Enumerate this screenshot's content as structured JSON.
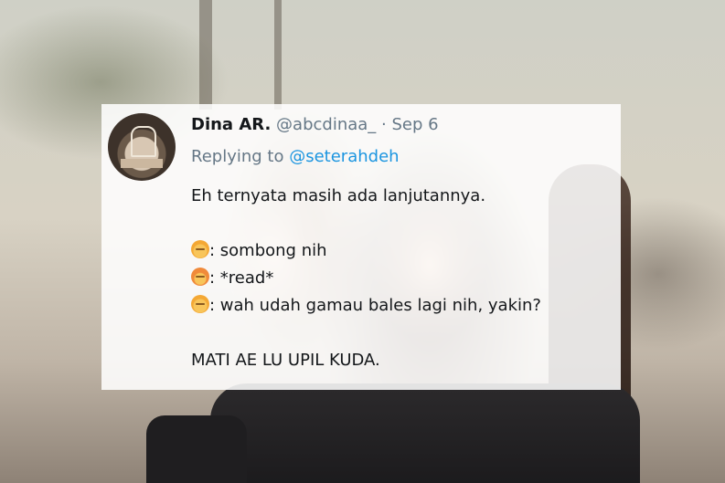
{
  "tweet": {
    "display_name": "Dina AR.",
    "handle": "@abcdinaa_",
    "separator": "·",
    "date": "Sep 6",
    "replying_prefix": "Replying to",
    "replying_to": "@seterahdeh",
    "lines": [
      "Eh ternyata masih ada lanjutannya.",
      "",
      ": sombong nih",
      ": *read*",
      ": wah udah gamau bales lagi nih, yakin?",
      "",
      "MATI AE LU UPIL KUDA."
    ],
    "line_icons": [
      "",
      "",
      "boy-emoji-icon",
      "girl-emoji-icon",
      "boy-emoji-icon",
      "",
      ""
    ]
  },
  "colors": {
    "name": "#14171a",
    "meta": "#657786",
    "mention": "#1b95e0"
  }
}
